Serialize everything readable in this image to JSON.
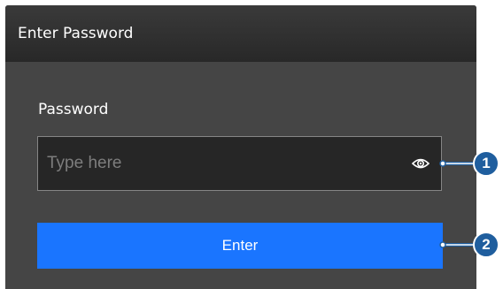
{
  "dialog": {
    "title": "Enter Password"
  },
  "password_field": {
    "label": "Password",
    "placeholder": "Type here",
    "value": "",
    "toggle_icon": "eye-icon"
  },
  "enter_button": {
    "label": "Enter"
  },
  "callouts": {
    "first": "1",
    "second": "2"
  },
  "colors": {
    "dialog_background": "#454545",
    "titlebar_background": "#2e2e2e",
    "input_background": "#262626",
    "button_background": "#1a75ff",
    "callout_fill": "#1f5e9e"
  }
}
